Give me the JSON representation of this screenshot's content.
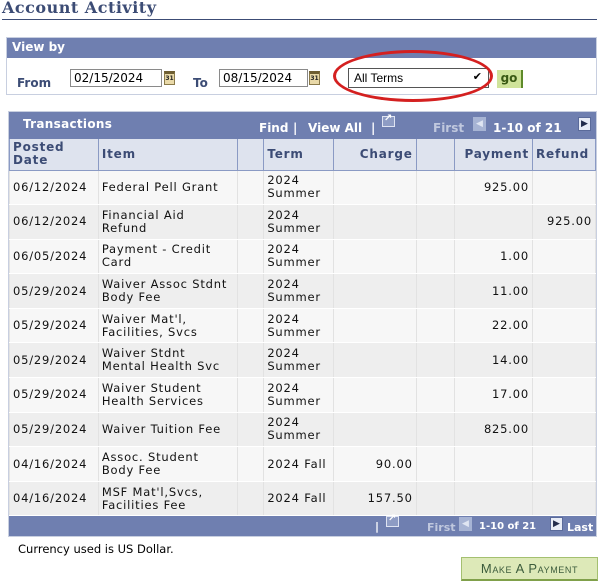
{
  "page": {
    "title": "Account Activity"
  },
  "view_by": {
    "header": "View by",
    "from_label": "From",
    "from_value": "02/15/2024",
    "to_label": "To",
    "to_value": "08/15/2024",
    "calendar_icon_text": "31",
    "term_select_value": "All Terms",
    "go_label": "go"
  },
  "grid": {
    "title": "Transactions",
    "find_label": "Find",
    "view_all_label": "View All",
    "first_label": "First",
    "last_label": "Last",
    "range_label": "1-10 of 21",
    "separator": "|",
    "columns": [
      {
        "label": "Posted Date"
      },
      {
        "label": "Item"
      },
      {
        "label": ""
      },
      {
        "label": "Term"
      },
      {
        "label": "Charge"
      },
      {
        "label": ""
      },
      {
        "label": "Payment"
      },
      {
        "label": "Refund"
      }
    ],
    "rows": [
      {
        "date": "06/12/2024",
        "item": "Federal Pell Grant",
        "term": "2024 Summer",
        "charge": "",
        "payment": "925.00",
        "refund": ""
      },
      {
        "date": "06/12/2024",
        "item": "Financial Aid Refund",
        "term": "2024 Summer",
        "charge": "",
        "payment": "",
        "refund": "925.00"
      },
      {
        "date": "06/05/2024",
        "item": "Payment - Credit Card",
        "term": "2024 Summer",
        "charge": "",
        "payment": "1.00",
        "refund": ""
      },
      {
        "date": "05/29/2024",
        "item": "Waiver Assoc Stdnt Body Fee",
        "term": "2024 Summer",
        "charge": "",
        "payment": "11.00",
        "refund": ""
      },
      {
        "date": "05/29/2024",
        "item": "Waiver Mat'l, Facilities, Svcs",
        "term": "2024 Summer",
        "charge": "",
        "payment": "22.00",
        "refund": ""
      },
      {
        "date": "05/29/2024",
        "item": "Waiver Stdnt Mental Health Svc",
        "term": "2024 Summer",
        "charge": "",
        "payment": "14.00",
        "refund": ""
      },
      {
        "date": "05/29/2024",
        "item": "Waiver Student Health Services",
        "term": "2024 Summer",
        "charge": "",
        "payment": "17.00",
        "refund": ""
      },
      {
        "date": "05/29/2024",
        "item": "Waiver Tuition Fee",
        "term": "2024 Summer",
        "charge": "",
        "payment": "825.00",
        "refund": ""
      },
      {
        "date": "04/16/2024",
        "item": "Assoc. Student Body Fee",
        "term": "2024 Fall",
        "charge": "90.00",
        "payment": "",
        "refund": ""
      },
      {
        "date": "04/16/2024",
        "item": "MSF Mat'l,Svcs, Facilities Fee",
        "term": "2024 Fall",
        "charge": "157.50",
        "payment": "",
        "refund": ""
      }
    ]
  },
  "footer": {
    "currency_note": "Currency used is US Dollar.",
    "make_payment_label": "Make A Payment"
  },
  "colors": {
    "header_bar": "#6f7fb0",
    "title_text": "#3c4c75",
    "column_header_bg": "#dee3ee",
    "highlight_oval": "#d42020",
    "go_button_bg": "#cfe39a",
    "payment_button_bg": "#dde9b8"
  }
}
